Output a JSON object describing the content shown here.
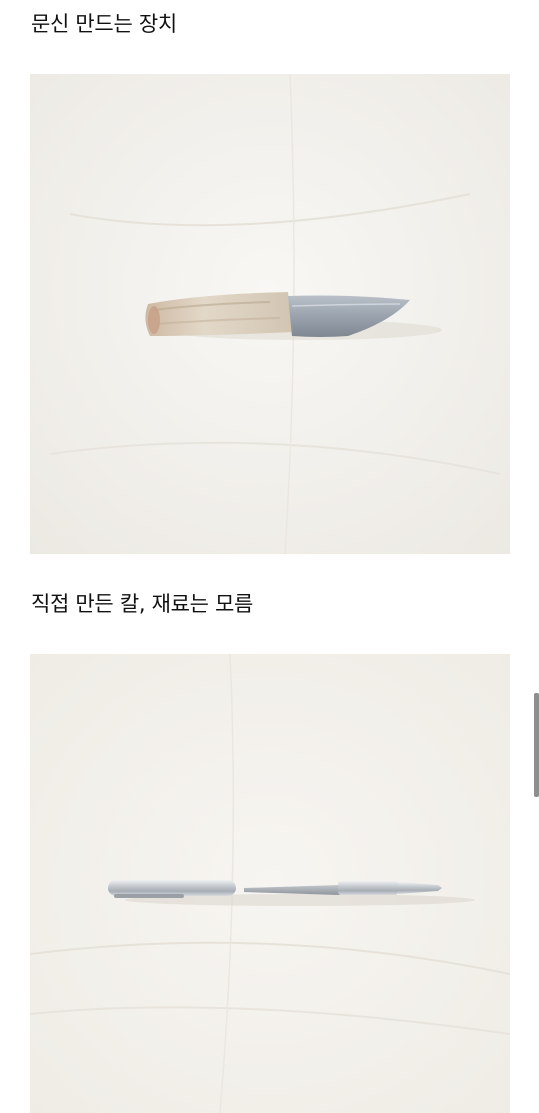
{
  "post": {
    "items": [
      {
        "caption": "문신 만드는 장치"
      },
      {
        "caption": "직접 만든 칼, 재료는 모름"
      }
    ]
  },
  "images": [
    {
      "subject": "knife-with-fur-handle"
    },
    {
      "subject": "pen-with-hidden-blade"
    }
  ]
}
